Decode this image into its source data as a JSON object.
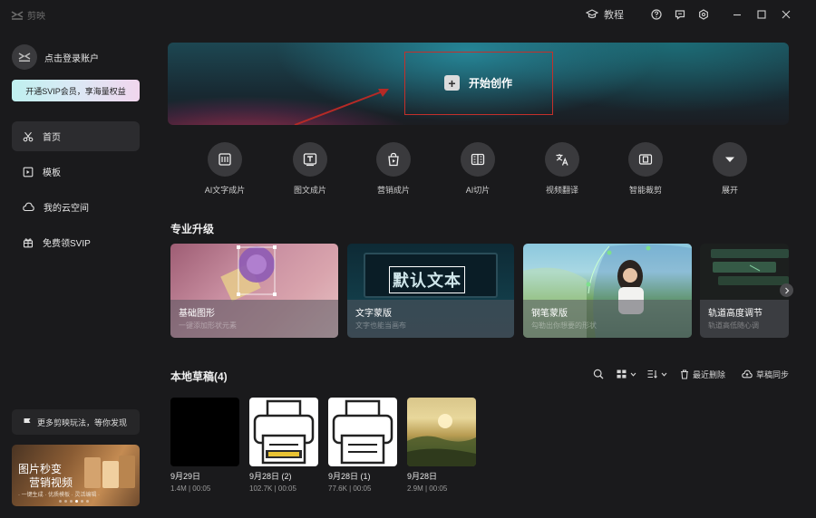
{
  "app": {
    "name": "剪映"
  },
  "titlebar": {
    "tutorial_label": "教程",
    "icons": [
      "graduation-cap-icon",
      "help-icon",
      "feedback-icon",
      "settings-icon",
      "minimize-icon",
      "maximize-icon",
      "close-icon"
    ]
  },
  "sidebar": {
    "login_label": "点击登录账户",
    "svip_banner": "开通SVIP会员，享海量权益",
    "nav": [
      {
        "label": "首页",
        "icon": "scissors-icon",
        "active": true
      },
      {
        "label": "模板",
        "icon": "template-icon",
        "active": false
      },
      {
        "label": "我的云空间",
        "icon": "cloud-icon",
        "active": false
      },
      {
        "label": "免费领SVIP",
        "icon": "gift-icon",
        "active": false
      }
    ],
    "discover_label": "更多剪映玩法，等你发现",
    "promo": {
      "line1": "图片秒变",
      "line2": "营销视频",
      "line3": "· 一键生成 · 优质模板 · 灵活编辑 ·",
      "slides": 6,
      "active_slide": 3
    }
  },
  "hero": {
    "start_label": "开始创作"
  },
  "tools": [
    {
      "label": "AI文字成片",
      "icon": "ai-text-video-icon"
    },
    {
      "label": "图文成片",
      "icon": "image-text-video-icon"
    },
    {
      "label": "营销成片",
      "icon": "marketing-bag-icon"
    },
    {
      "label": "AI切片",
      "icon": "ai-slice-icon"
    },
    {
      "label": "视频翻译",
      "icon": "translate-icon"
    },
    {
      "label": "智能裁剪",
      "icon": "smart-crop-icon"
    },
    {
      "label": "展开",
      "icon": "expand-chevron-icon"
    }
  ],
  "pro_section": {
    "title": "专业升级",
    "cards": [
      {
        "title": "基础图形",
        "subtitle": "一键添加形状元素"
      },
      {
        "title": "文字蒙版",
        "subtitle": "文字也能当画布",
        "preview_text": "默认文本"
      },
      {
        "title": "钢笔蒙版",
        "subtitle": "勾勒出你想要的形状"
      },
      {
        "title": "轨道高度调节",
        "subtitle": "轨道高低随心调"
      }
    ]
  },
  "drafts_section": {
    "title": "本地草稿(4)",
    "recent_delete_label": "最近删除",
    "sync_label": "草稿同步",
    "drafts": [
      {
        "date": "9月29日",
        "meta": "1.4M | 00:05",
        "thumb": "black"
      },
      {
        "date": "9月28日 (2)",
        "meta": "102.7K | 00:05",
        "thumb": "printer"
      },
      {
        "date": "9月28日 (1)",
        "meta": "77.6K | 00:05",
        "thumb": "printer"
      },
      {
        "date": "9月28日",
        "meta": "2.9M | 00:05",
        "thumb": "landscape"
      }
    ]
  }
}
